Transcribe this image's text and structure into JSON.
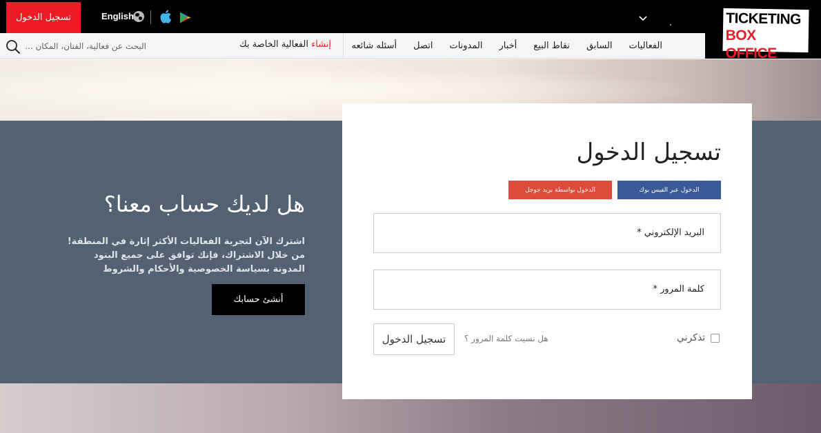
{
  "header": {
    "login_button": "تسجيل الدخول",
    "language": "English",
    "logo": {
      "line1": "TICKETING",
      "line2": "BOX OFFICE"
    }
  },
  "nav": {
    "search_placeholder": "البحث عن فعالية، الفنان، المكان ...",
    "create_event_highlight": "إنشاء",
    "create_event_rest": " الفعالية الخاصة بك",
    "items": [
      "الفعاليات",
      "السابق",
      "نقاط البيع",
      "أخبار",
      "المدونات",
      "اتصل",
      "أسئله شائعه"
    ]
  },
  "signup_panel": {
    "title": "هل لديك حساب معنا؟",
    "text": "اشترك الآن لتجربة الفعاليات الأكثر إثارة في المنطقة! من خلال الاشتراك، فإنك توافق على جميع البنود المدونة بسياسة الخصوصية والأحكام والشروط",
    "button": "أنشئ حسابك"
  },
  "login_card": {
    "title": "تسجيل الدخول",
    "facebook_button": "الدخول عبر الفيس بوك",
    "google_button": "الدخول بواسطة بريد جوجل",
    "email_label": "البريد الإلكتروني *",
    "password_label": "كلمة المرور *",
    "remember_label": "تذكرني",
    "forgot_link": "هل نسيت كلمة المرور ؟",
    "submit_button": "تسجيل الدخول"
  },
  "colors": {
    "accent_red": "#ed1c24",
    "panel": "#526272",
    "facebook": "#3b5998",
    "google": "#dd4b39"
  }
}
